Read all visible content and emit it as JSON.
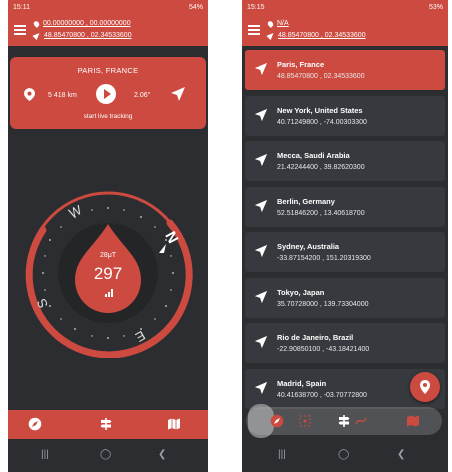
{
  "left": {
    "status": {
      "time": "15:11",
      "battery": "54%"
    },
    "header": {
      "coord1": "00.00000000 , 00.00000000",
      "coord2": "48.85470800 , 02.34533600"
    },
    "target": {
      "title": "PARIS, FRANCE",
      "distance": "5 418 km",
      "bearing": "2.06°",
      "track_label": "start live tracking"
    },
    "compass": {
      "field": "28μT",
      "heading": "297",
      "letters": {
        "n": "N",
        "e": "E",
        "s": "S",
        "w": "W"
      }
    },
    "bottom_nav": [
      "compass-icon",
      "signpost-icon",
      "map-icon"
    ]
  },
  "right": {
    "status": {
      "time": "15:15",
      "battery": "53%"
    },
    "header": {
      "coord1": "N/A",
      "coord2": "48.85470800 , 02.34533600"
    },
    "locations": [
      {
        "name": "Paris, France",
        "coords": "48.85470800 , 02.34533600",
        "active": true
      },
      {
        "name": "New York, United States",
        "coords": "40.71249800 , -74.00303300"
      },
      {
        "name": "Mecca, Saudi Arabia",
        "coords": "21.42244400 , 39.82620300"
      },
      {
        "name": "Berlin, Germany",
        "coords": "52.51846200 , 13.40618700"
      },
      {
        "name": "Sydney, Australia",
        "coords": "-33.87154200 , 151.20319300"
      },
      {
        "name": "Tokyo, Japan",
        "coords": "35.70728000 , 139.73304000"
      },
      {
        "name": "Rio de Janeiro, Brazil",
        "coords": "-22.90850100 , -43.18421400"
      },
      {
        "name": "Madrid, Spain",
        "coords": "40.41638700 , -03.70772800"
      }
    ]
  },
  "colors": {
    "accent": "#cc4a3f",
    "background": "#2b2d30",
    "card": "#36393d"
  }
}
